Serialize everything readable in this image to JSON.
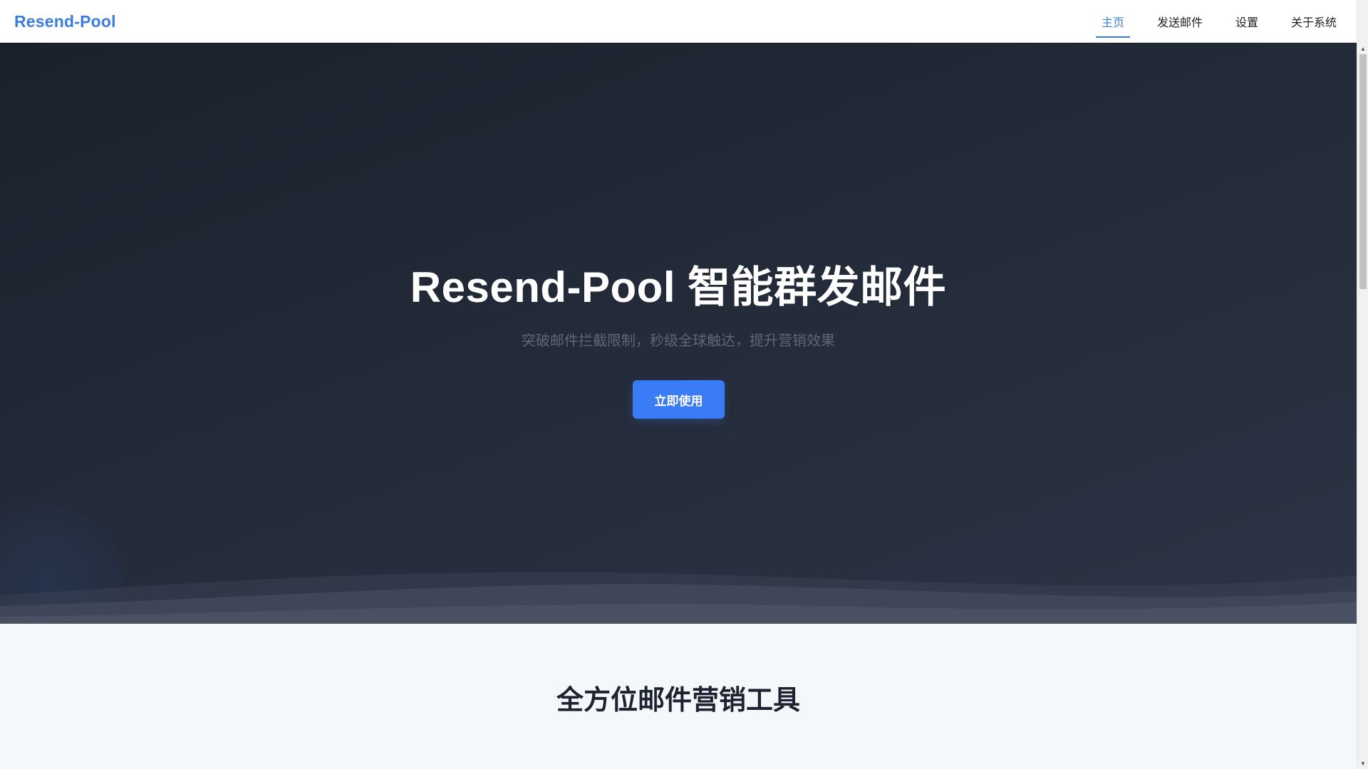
{
  "header": {
    "brand": "Resend-Pool",
    "nav": [
      {
        "label": "主页",
        "active": true
      },
      {
        "label": "发送邮件",
        "active": false
      },
      {
        "label": "设置",
        "active": false
      },
      {
        "label": "关于系统",
        "active": false
      }
    ]
  },
  "hero": {
    "title": "Resend-Pool 智能群发邮件",
    "subtitle": "突破邮件拦截限制，秒级全球触达，提升营销效果",
    "cta_label": "立即使用"
  },
  "features": {
    "title": "全方位邮件营销工具"
  },
  "colors": {
    "accent": "#3b7ddd",
    "button": "#3a7cf5",
    "hero_dark": "#1b212c",
    "section_bg": "#f5f8fb"
  },
  "icons": {
    "scroll_up": "triangle-up-icon",
    "scroll_down": "triangle-down-icon"
  }
}
